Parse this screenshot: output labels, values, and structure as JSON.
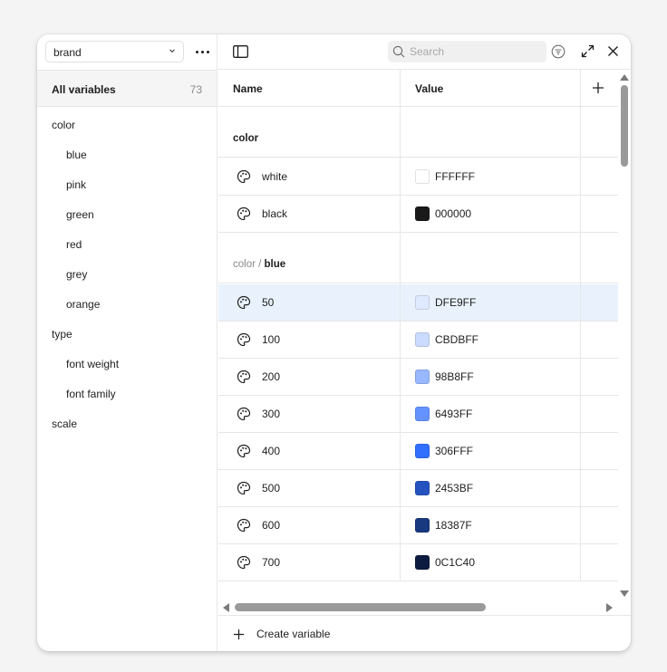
{
  "sidebar": {
    "collection": "brand",
    "all_variables_label": "All variables",
    "all_variables_count": "73",
    "groups": [
      {
        "label": "color",
        "level": 0
      },
      {
        "label": "blue",
        "level": 1
      },
      {
        "label": "pink",
        "level": 1
      },
      {
        "label": "green",
        "level": 1
      },
      {
        "label": "red",
        "level": 1
      },
      {
        "label": "grey",
        "level": 1
      },
      {
        "label": "orange",
        "level": 1
      },
      {
        "label": "type",
        "level": 0
      },
      {
        "label": "font weight",
        "level": 1
      },
      {
        "label": "font family",
        "level": 1
      },
      {
        "label": "scale",
        "level": 0
      }
    ]
  },
  "toolbar": {
    "search_placeholder": "Search"
  },
  "table": {
    "col_name": "Name",
    "col_value": "Value",
    "sections": [
      {
        "parent": "",
        "name": "color",
        "rows": [
          {
            "name": "white",
            "value": "FFFFFF",
            "color": "#FFFFFF"
          },
          {
            "name": "black",
            "value": "000000",
            "color": "#1A1A1A"
          }
        ]
      },
      {
        "parent": "color / ",
        "name": "blue",
        "rows": [
          {
            "name": "50",
            "value": "DFE9FF",
            "color": "#DFE9FF"
          },
          {
            "name": "100",
            "value": "CBDBFF",
            "color": "#CBDBFF"
          },
          {
            "name": "200",
            "value": "98B8FF",
            "color": "#98B8FF"
          },
          {
            "name": "300",
            "value": "6493FF",
            "color": "#6493FF"
          },
          {
            "name": "400",
            "value": "306FFF",
            "color": "#306FFF"
          },
          {
            "name": "500",
            "value": "2453BF",
            "color": "#2453BF"
          },
          {
            "name": "600",
            "value": "18387F",
            "color": "#18387F"
          },
          {
            "name": "700",
            "value": "0C1C40",
            "color": "#0C1C40"
          }
        ]
      }
    ],
    "selected_row": "50"
  },
  "footer": {
    "create_label": "Create variable"
  }
}
